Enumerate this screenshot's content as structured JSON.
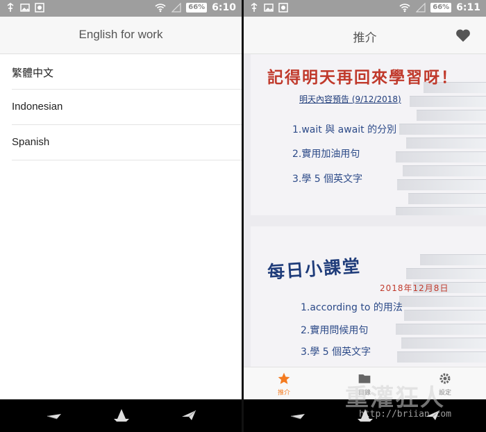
{
  "left_screen": {
    "status": {
      "battery": "66%",
      "time": "6:10"
    },
    "appbar": {
      "title": "English for work"
    },
    "languages": [
      {
        "label": "繁體中文"
      },
      {
        "label": "Indonesian"
      },
      {
        "label": "Spanish"
      }
    ]
  },
  "right_screen": {
    "status": {
      "battery": "66%",
      "time": "6:11"
    },
    "appbar": {
      "title": "推介"
    },
    "card1": {
      "headline": "記得明天再回來學習呀！",
      "subtitle": "明天內容預告 (9/12/2018)",
      "items": [
        "1.wait 與 await 的分別",
        "2.實用加油用句",
        "3.學 5 個英文字"
      ]
    },
    "card2": {
      "headline": "每日小課堂",
      "date": "2018年12月8日",
      "items": [
        "1.according to 的用法",
        "2.實用問候用句",
        "3.學 5 個英文字"
      ]
    },
    "tabs": [
      {
        "label": "推介",
        "icon": "star-icon",
        "active": true
      },
      {
        "label": "目錄",
        "icon": "folder-icon",
        "active": false
      },
      {
        "label": "設定",
        "icon": "gear-icon",
        "active": false
      }
    ]
  },
  "watermark": {
    "text": "重灌狂人",
    "url": "http://briian.com"
  },
  "colors": {
    "accent_orange": "#f47b20",
    "status_bar": "#9e9e9e",
    "headline_red": "#c0392b",
    "headline_blue": "#1f3c7a"
  }
}
